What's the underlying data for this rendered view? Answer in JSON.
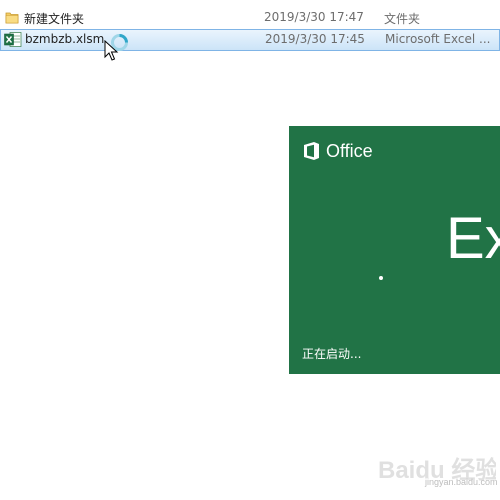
{
  "files": [
    {
      "name": "新建文件夹",
      "date": "2019/3/30 17:47",
      "type": "文件夹",
      "icon": "folder-icon",
      "selected": false
    },
    {
      "name": "bzmbzb.xlsm",
      "date": "2019/3/30 17:45",
      "type": "Microsoft Excel ...",
      "icon": "excel-file-icon",
      "selected": true
    }
  ],
  "cursor": {
    "icon": "busy-cursor-icon"
  },
  "splash": {
    "brand": "Office",
    "app": "Ex",
    "status": "正在启动...",
    "background_color": "#217346",
    "text_color": "#ffffff"
  },
  "watermark": {
    "text": "Baidu 经验",
    "sub": "jingyan.baidu.com"
  },
  "colors": {
    "selection": "#cce4f8",
    "selection_border": "#7fb4e6",
    "folder": "#e8b84a"
  }
}
